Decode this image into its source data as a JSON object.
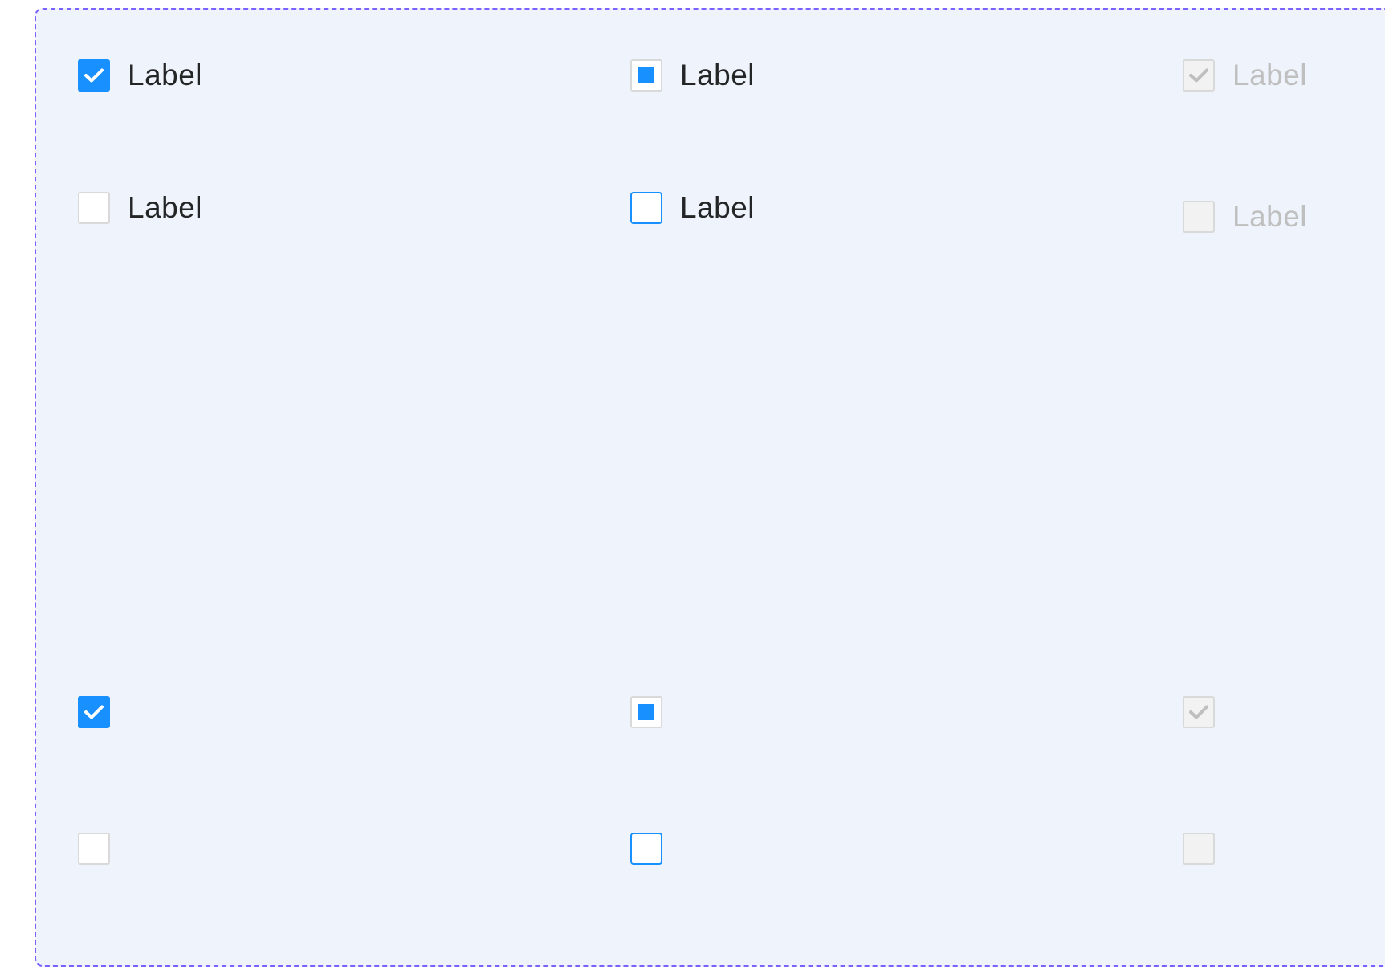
{
  "checkboxes": {
    "r1c1": {
      "label": "Label",
      "state": "checked",
      "icon": "check-icon"
    },
    "r1c2": {
      "label": "Label",
      "state": "indeterminate",
      "icon": "indeterminate-square-icon"
    },
    "r1c3": {
      "label": "Label",
      "state": "disabled-checked",
      "icon": "check-icon"
    },
    "r2c1": {
      "label": "Label",
      "state": "unchecked"
    },
    "r2c2": {
      "label": "Label",
      "state": "focus-unchecked"
    },
    "r2c3": {
      "label": "Label",
      "state": "disabled-unchecked"
    },
    "r3c1": {
      "state": "checked",
      "icon": "check-icon"
    },
    "r3c2": {
      "state": "indeterminate",
      "icon": "indeterminate-square-icon"
    },
    "r3c3": {
      "state": "disabled-checked",
      "icon": "check-icon"
    },
    "r4c1": {
      "state": "unchecked"
    },
    "r4c2": {
      "state": "focus-unchecked"
    },
    "r4c3": {
      "state": "disabled-unchecked"
    }
  },
  "colors": {
    "primary": "#1890FF",
    "frame_border": "#7B61FF",
    "frame_bg": "#EEF3FC",
    "text": "#262626",
    "disabled_text": "#BFBFBF",
    "disabled_bg": "#F2F2F2",
    "border": "#D9D9D9"
  }
}
